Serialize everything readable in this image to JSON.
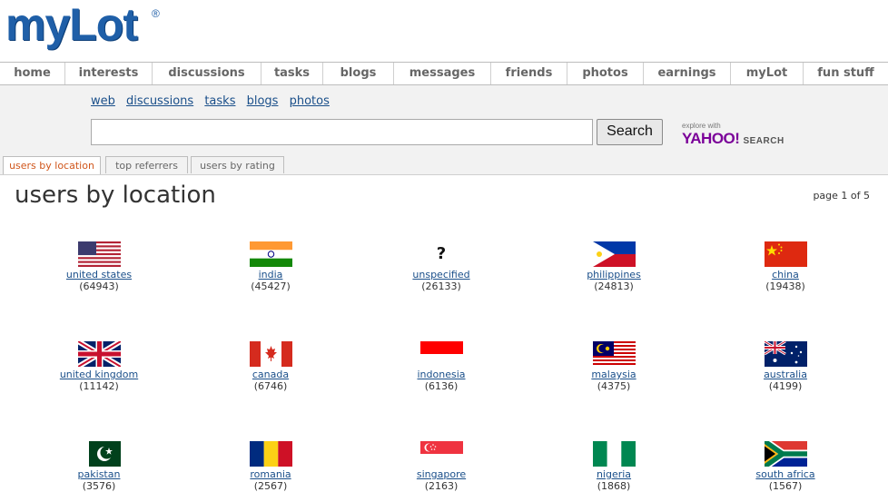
{
  "logo": {
    "text": "mylot_logo_word",
    "display": "myLot",
    "reg": "®"
  },
  "nav": [
    "home",
    "interests",
    "discussions",
    "tasks",
    "blogs",
    "messages",
    "friends",
    "photos",
    "earnings",
    "myLot",
    "fun stuff"
  ],
  "search": {
    "links": [
      "web",
      "discussions",
      "tasks",
      "blogs",
      "photos"
    ],
    "input_value": "",
    "button_label": "Search",
    "powered_explore": "explore with",
    "powered_brand": "YAHOO!",
    "powered_search": "SEARCH"
  },
  "tabs": [
    "users by location",
    "top referrers",
    "users by rating"
  ],
  "main": {
    "title": "users by location",
    "page_info": "page 1 of 5"
  },
  "countries": [
    {
      "name": "united states",
      "count": "(64943)",
      "flag": "us"
    },
    {
      "name": "india",
      "count": "(45427)",
      "flag": "in"
    },
    {
      "name": "unspecified",
      "count": "(26133)",
      "flag": "unknown"
    },
    {
      "name": "philippines",
      "count": "(24813)",
      "flag": "ph"
    },
    {
      "name": "china",
      "count": "(19438)",
      "flag": "cn"
    },
    {
      "name": "united kingdom",
      "count": "(11142)",
      "flag": "gb"
    },
    {
      "name": "canada",
      "count": "(6746)",
      "flag": "ca"
    },
    {
      "name": "indonesia",
      "count": "(6136)",
      "flag": "id"
    },
    {
      "name": "malaysia",
      "count": "(4375)",
      "flag": "my"
    },
    {
      "name": "australia",
      "count": "(4199)",
      "flag": "au"
    },
    {
      "name": "pakistan",
      "count": "(3576)",
      "flag": "pk"
    },
    {
      "name": "romania",
      "count": "(2567)",
      "flag": "ro"
    },
    {
      "name": "singapore",
      "count": "(2163)",
      "flag": "sg"
    },
    {
      "name": "nigeria",
      "count": "(1868)",
      "flag": "ng"
    },
    {
      "name": "south africa",
      "count": "(1567)",
      "flag": "za"
    }
  ],
  "unknown_flag_glyph": "?"
}
